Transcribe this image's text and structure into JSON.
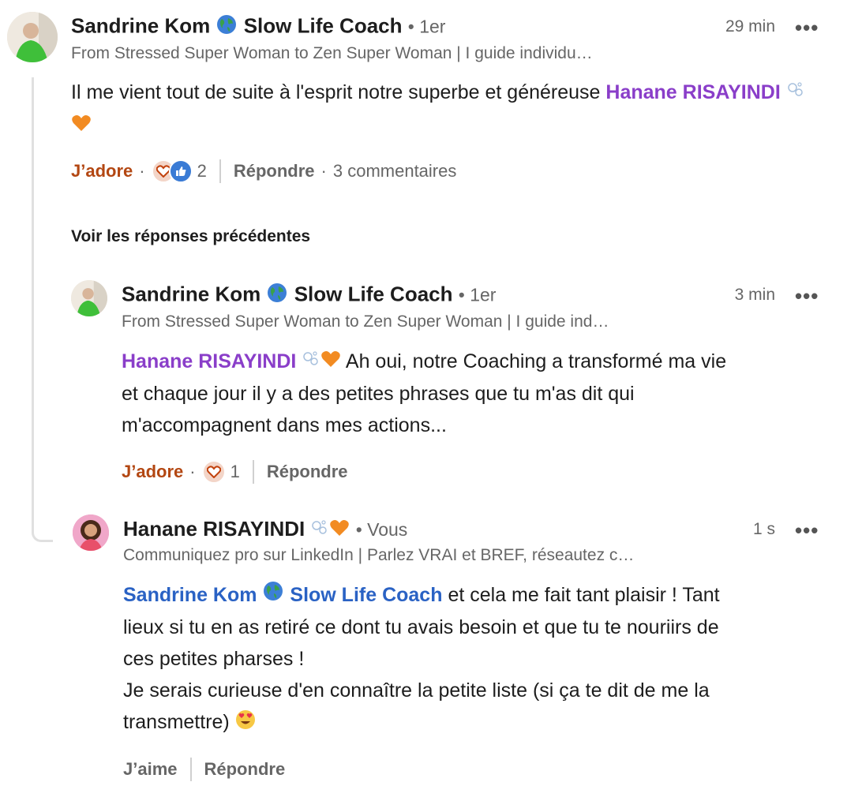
{
  "comment1": {
    "author": "Sandrine Kom",
    "author_suffix": "Slow Life Coach",
    "degree": "1er",
    "headline": "From Stressed Super Woman to Zen Super Woman | I guide individu…",
    "time": "29 min",
    "text_before": "Il me vient tout de suite à l'esprit notre superbe et généreuse",
    "mention": "Hanane RISAYINDI",
    "reaction_label": "J’adore",
    "reaction_count": "2",
    "reply_label": "Répondre",
    "comments_label": "3 commentaires"
  },
  "voir_precedentes": "Voir les réponses précédentes",
  "reply1": {
    "author": "Sandrine Kom",
    "author_suffix": "Slow Life Coach",
    "degree": "1er",
    "headline": "From Stressed Super Woman to Zen Super Woman | I guide ind…",
    "time": "3 min",
    "mention": "Hanane RISAYINDI",
    "text_line1": "Ah oui, notre Coaching a transformé ma vie",
    "text_line2": "et chaque jour il y a des petites phrases que tu m'as dit qui",
    "text_line3": "m'accompagnent dans mes actions...",
    "reaction_label": "J’adore",
    "reaction_count": "1",
    "reply_label": "Répondre"
  },
  "reply2": {
    "author": "Hanane RISAYINDI",
    "degree": "Vous",
    "headline": "Communiquez pro sur LinkedIn | Parlez VRAI et BREF, réseautez c…",
    "time": "1 s",
    "mention": "Sandrine Kom",
    "mention_suffix": "Slow Life Coach",
    "text_line1": "et cela me fait tant plaisir ! Tant",
    "text_line2": "lieux si tu en as retiré ce dont tu avais besoin et que tu te nouriirs de",
    "text_line3": "ces petites pharses !",
    "text_line4": "Je serais curieuse d'en connaître la petite liste (si ça te dit de me la",
    "text_line5": "transmettre)",
    "like_label": "J’aime",
    "reply_label": "Répondre"
  },
  "more_label": "•••",
  "colors": {
    "mention_purple": "#8a3ec9",
    "mention_blue": "#2a62c4",
    "reaction_red": "#b34712"
  }
}
